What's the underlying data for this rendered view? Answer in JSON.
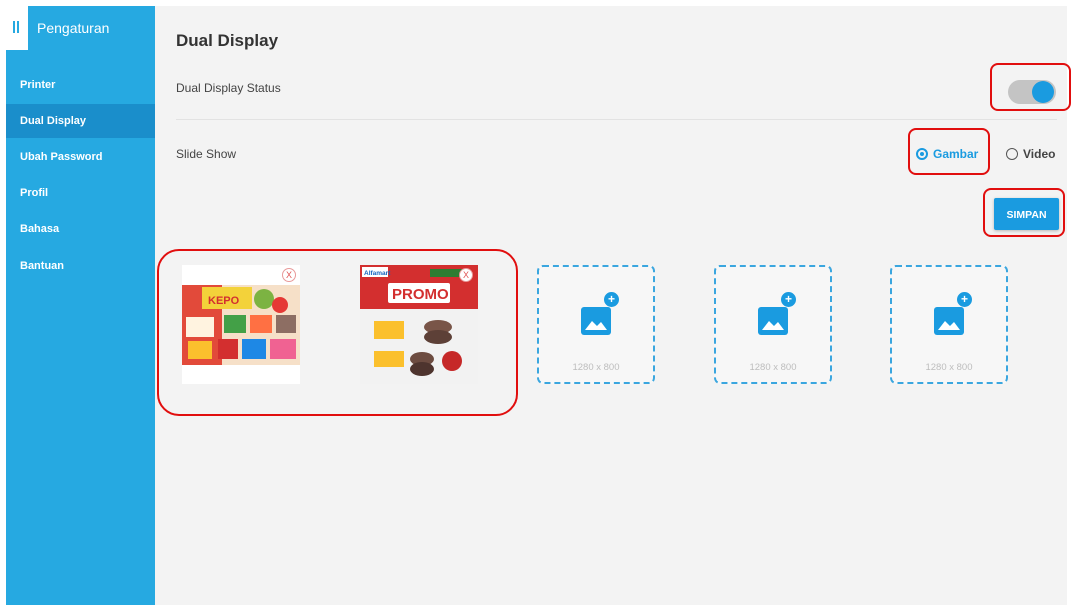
{
  "sidebar": {
    "title": "Pengaturan",
    "items": [
      {
        "label": "Printer"
      },
      {
        "label": "Dual Display"
      },
      {
        "label": "Ubah Password"
      },
      {
        "label": "Profil"
      },
      {
        "label": "Bahasa"
      },
      {
        "label": "Bantuan"
      }
    ]
  },
  "main": {
    "title": "Dual Display",
    "status_label": "Dual Display Status",
    "status_on": true,
    "slideshow_label": "Slide Show",
    "options": [
      {
        "label": "Gambar",
        "selected": true
      },
      {
        "label": "Video",
        "selected": false
      }
    ],
    "save_label": "SIMPAN"
  },
  "images": {
    "uploaded": [
      {
        "name": "promo-flyer-1",
        "text": "KEPO",
        "remove_label": "X"
      },
      {
        "name": "promo-flyer-2",
        "brand": "Alfamart",
        "text": "PROMO",
        "remove_label": "X"
      }
    ],
    "empty_slots": [
      {
        "size": "1280 x 800"
      },
      {
        "size": "1280 x 800"
      },
      {
        "size": "1280 x 800"
      }
    ]
  },
  "colors": {
    "sidebar": "#26a9e1",
    "sidebar_active": "#1a8ecb",
    "accent": "#1a9be0",
    "highlight": "#e10e0e"
  }
}
